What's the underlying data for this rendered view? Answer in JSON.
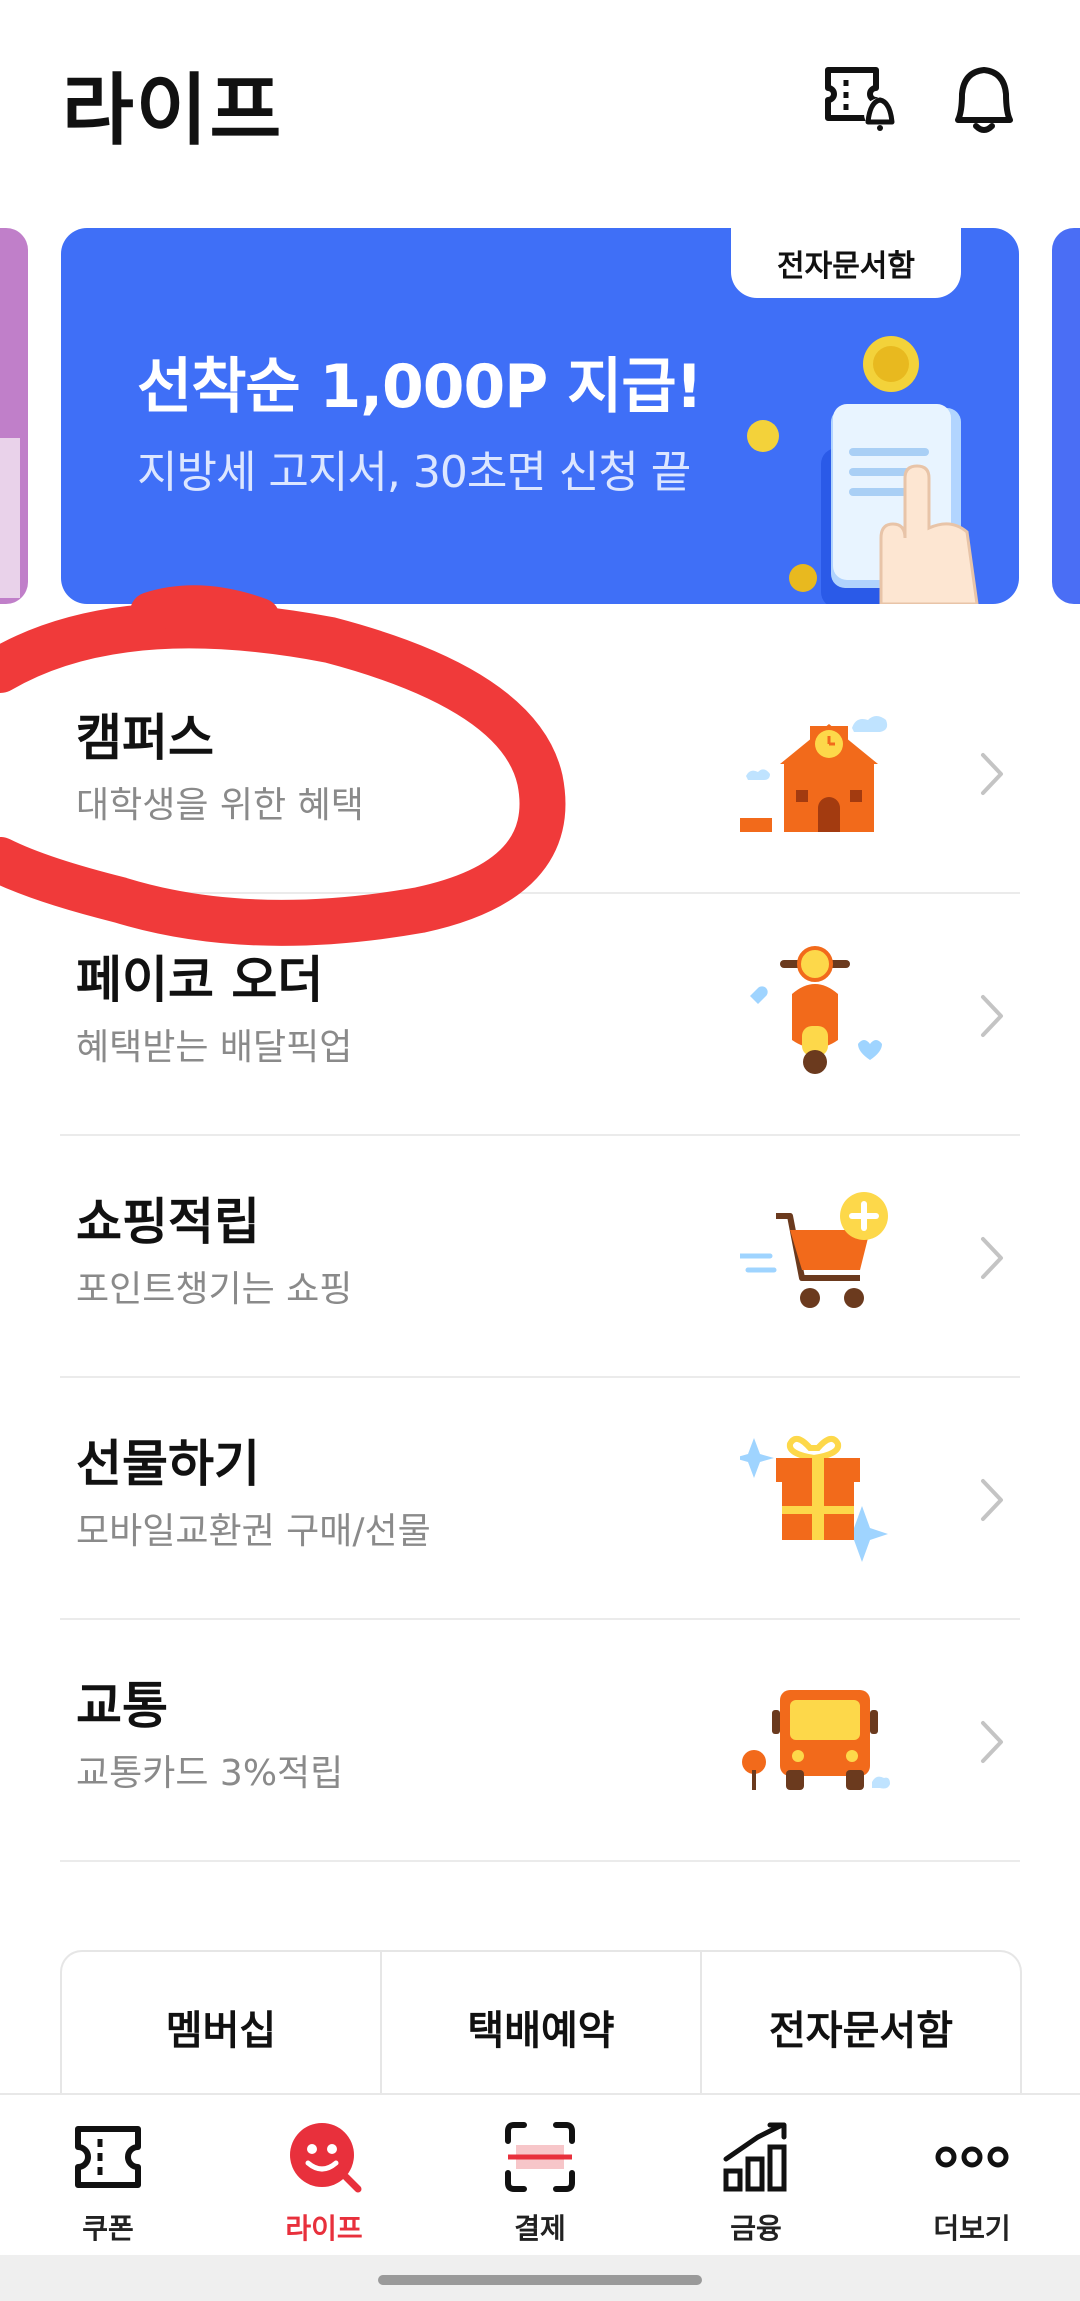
{
  "header": {
    "title": "라이프",
    "icons": [
      "ticket-bell-icon",
      "bell-icon"
    ]
  },
  "banner": {
    "tag": "전자문서함",
    "title": "선착순 1,000P 지급!",
    "subtitle": "지방세 고지서, 30초면 신청 끝"
  },
  "menu": [
    {
      "title": "캠퍼스",
      "subtitle": "대학생을 위한 혜택",
      "icon": "campus-building-icon"
    },
    {
      "title": "페이코 오더",
      "subtitle": "혜택받는 배달픽업",
      "icon": "scooter-icon"
    },
    {
      "title": "쇼핑적립",
      "subtitle": "포인트챙기는 쇼핑",
      "icon": "shopping-cart-icon"
    },
    {
      "title": "선물하기",
      "subtitle": "모바일교환권 구매/선물",
      "icon": "gift-box-icon"
    },
    {
      "title": "교통",
      "subtitle": "교통카드 3%적립",
      "icon": "bus-icon"
    }
  ],
  "quick_links": [
    "멤버십",
    "택배예약",
    "전자문서함"
  ],
  "bottom_nav": [
    {
      "label": "쿠폰",
      "icon": "coupon-icon",
      "active": false
    },
    {
      "label": "라이프",
      "icon": "smile-life-icon",
      "active": true
    },
    {
      "label": "결제",
      "icon": "scan-pay-icon",
      "active": false
    },
    {
      "label": "금융",
      "icon": "finance-chart-icon",
      "active": false
    },
    {
      "label": "더보기",
      "icon": "more-dots-icon",
      "active": false
    }
  ],
  "colors": {
    "accent_red": "#e8303c",
    "banner_blue": "#3f6ff7",
    "illustration_orange": "#f26a1b",
    "annotation_red": "#f03a3a"
  }
}
